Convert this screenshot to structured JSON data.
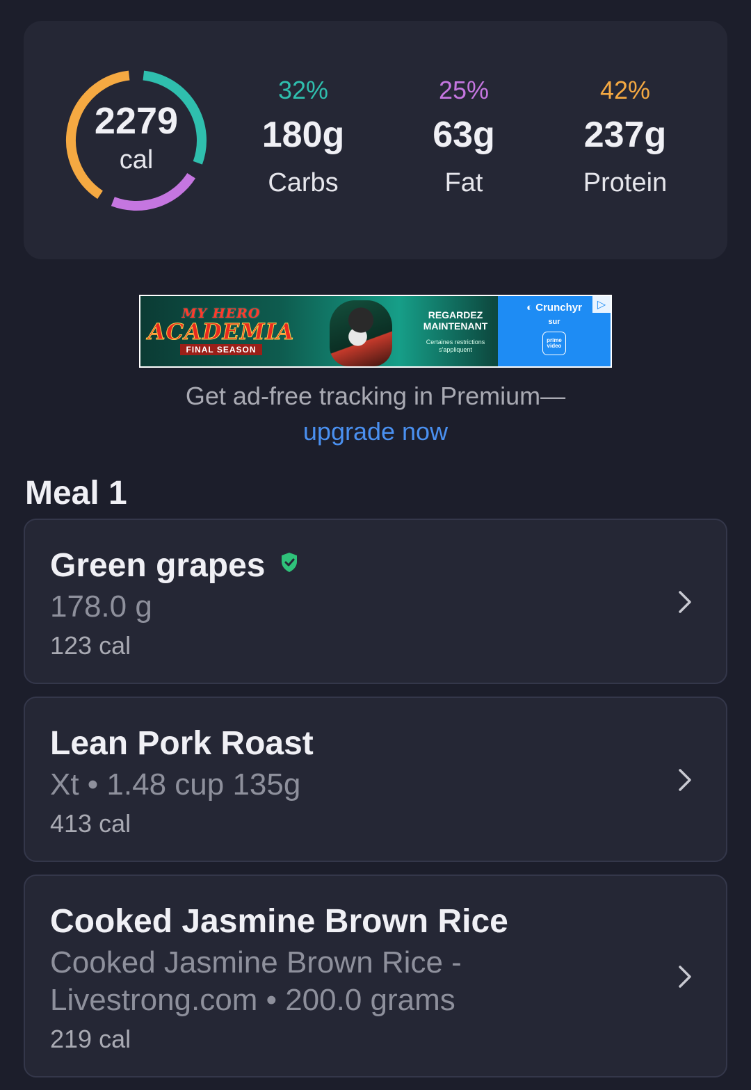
{
  "summary": {
    "calories_value": "2279",
    "calories_unit": "cal",
    "ring": {
      "carbs_fraction": 0.32,
      "fat_fraction": 0.25,
      "protein_fraction": 0.42,
      "carbs_color": "#2fbfae",
      "fat_color": "#c576e0",
      "protein_color": "#f5a942"
    },
    "macros": [
      {
        "pct": "32%",
        "grams": "180g",
        "name": "Carbs",
        "color": "#2fbfae"
      },
      {
        "pct": "25%",
        "grams": "63g",
        "name": "Fat",
        "color": "#c576e0"
      },
      {
        "pct": "42%",
        "grams": "237g",
        "name": "Protein",
        "color": "#f5a942"
      }
    ]
  },
  "ad": {
    "title_line1": "MY HERO",
    "title_line2": "ACADEMIA",
    "title_line3": "FINAL SEASON",
    "cta_line1": "REGARDEZ",
    "cta_line2": "MAINTENANT",
    "fine_print_line1": "Certaines restrictions",
    "fine_print_line2": "s'appliquent",
    "brand": "Crunchyr",
    "sur": "sur",
    "prime_line1": "prime",
    "prime_line2": "video",
    "choices_icon": "adchoices-icon"
  },
  "premium": {
    "text": "Get ad-free tracking in Premium—",
    "link": "upgrade now"
  },
  "meal": {
    "title": "Meal 1",
    "items": [
      {
        "name": "Green grapes",
        "verified": true,
        "detail_line1": "178.0 g",
        "detail_line2": "",
        "calories": "123 cal"
      },
      {
        "name": "Lean Pork Roast",
        "verified": false,
        "detail_line1": "Xt • 1.48 cup 135g",
        "detail_line2": "",
        "calories": "413 cal"
      },
      {
        "name": "Cooked Jasmine Brown Rice",
        "verified": false,
        "detail_line1": "Cooked Jasmine Brown Rice -",
        "detail_line2": "Livestrong.com • 200.0 grams",
        "calories": "219 cal"
      }
    ]
  },
  "colors": {
    "background": "#1c1e2b",
    "card": "#252735",
    "link": "#4a90f0",
    "verified": "#2fc27a"
  }
}
